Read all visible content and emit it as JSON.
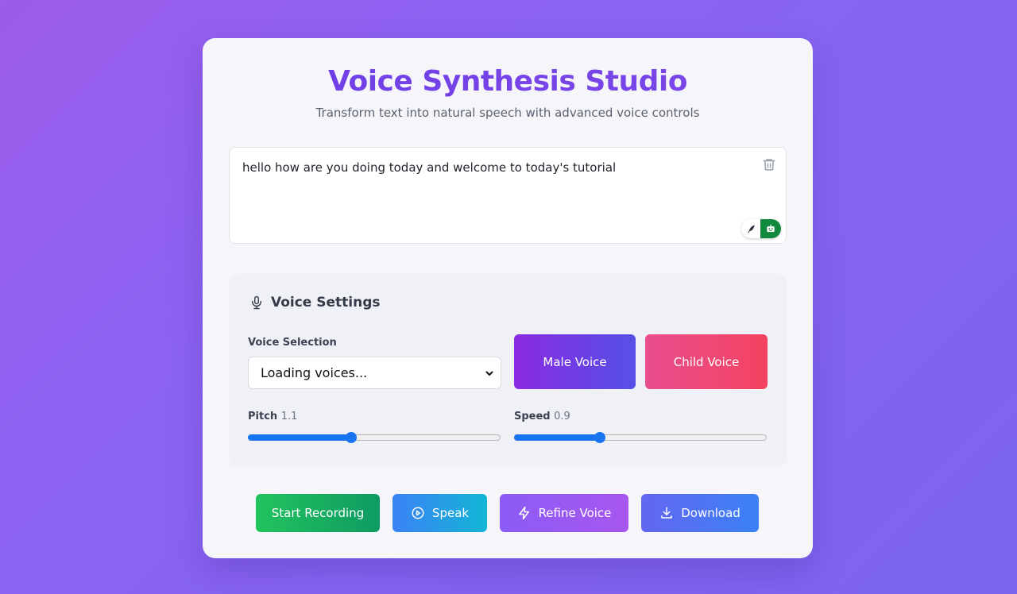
{
  "header": {
    "title": "Voice Synthesis Studio",
    "subtitle": "Transform text into natural speech with advanced voice controls"
  },
  "editor": {
    "text": "hello how are you doing today and welcome to today's tutorial",
    "clear_icon": "trash-icon",
    "extension_icons": [
      "quill-icon",
      "robot-icon"
    ]
  },
  "settings": {
    "heading": "Voice Settings",
    "heading_icon": "microphone-icon",
    "voice_selection_label": "Voice Selection",
    "voice_selection_value": "Loading voices...",
    "male_voice_label": "Male Voice",
    "child_voice_label": "Child Voice",
    "pitch": {
      "label": "Pitch",
      "value": "1.1",
      "fraction": 0.41
    },
    "speed": {
      "label": "Speed",
      "value": "0.9",
      "fraction": 0.34
    }
  },
  "actions": {
    "start_recording": "Start Recording",
    "speak": "Speak",
    "refine_voice": "Refine Voice",
    "download": "Download"
  },
  "colors": {
    "accent": "#6a3fe0",
    "slider": "#1a73f0"
  }
}
